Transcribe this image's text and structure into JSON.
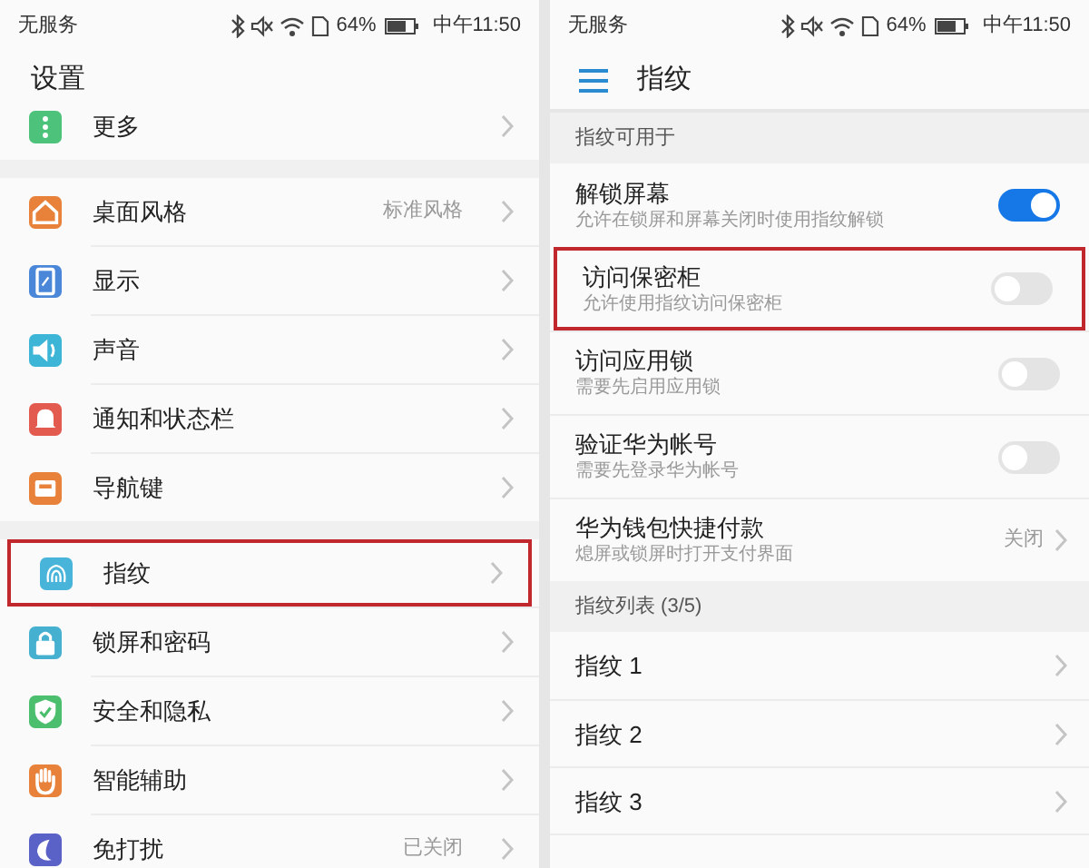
{
  "left_screen": {
    "status_bar": {
      "carrier": "无服务",
      "battery": "64%",
      "time": "中午11:50"
    },
    "title": "设置",
    "groups": [
      {
        "items": [
          {
            "label": "更多",
            "color": "#4cc27a",
            "highlighted": false
          }
        ]
      },
      {
        "items": [
          {
            "label": "桌面风格",
            "color": "#e8823a",
            "value": "标准风格",
            "highlighted": false
          },
          {
            "label": "显示",
            "color": "#4a87d8",
            "highlighted": false
          },
          {
            "label": "声音",
            "color": "#3db5d6",
            "highlighted": false
          },
          {
            "label": "通知和状态栏",
            "color": "#e35a4f",
            "highlighted": false
          },
          {
            "label": "导航键",
            "color": "#e8823a",
            "highlighted": false
          }
        ]
      },
      {
        "items": [
          {
            "label": "指纹",
            "color": "#48b4d9",
            "highlighted": true
          },
          {
            "label": "锁屏和密码",
            "color": "#46b0d0",
            "highlighted": false
          },
          {
            "label": "安全和隐私",
            "color": "#4cbf6e",
            "highlighted": false
          },
          {
            "label": "智能辅助",
            "color": "#e8823a",
            "highlighted": false
          },
          {
            "label": "免打扰",
            "color": "#5a62c8",
            "value": "已关闭",
            "highlighted": false
          }
        ]
      }
    ]
  },
  "right_screen": {
    "status_bar": {
      "carrier": "无服务",
      "battery": "64%",
      "time": "中午11:50"
    },
    "title": "指纹",
    "sections": [
      {
        "header": "指纹可用于",
        "items": [
          {
            "kind": "toggle",
            "title": "解锁屏幕",
            "subtitle": "允许在锁屏和屏幕关闭时使用指纹解锁",
            "on": true,
            "highlighted": false
          },
          {
            "kind": "toggle",
            "title": "访问保密柜",
            "subtitle": "允许使用指纹访问保密柜",
            "on": false,
            "highlighted": true
          },
          {
            "kind": "toggle",
            "title": "访问应用锁",
            "subtitle": "需要先启用应用锁",
            "on": false,
            "highlighted": false
          },
          {
            "kind": "toggle",
            "title": "验证华为帐号",
            "subtitle": "需要先登录华为帐号",
            "on": false,
            "highlighted": false
          },
          {
            "kind": "link",
            "title": "华为钱包快捷付款",
            "subtitle": "熄屏或锁屏时打开支付界面",
            "value": "关闭",
            "highlighted": false
          }
        ]
      },
      {
        "header": "指纹列表 (3/5)",
        "items": [
          {
            "kind": "link",
            "title": "指纹 1",
            "highlighted": false
          },
          {
            "kind": "link",
            "title": "指纹 2",
            "highlighted": false
          },
          {
            "kind": "link",
            "title": "指纹 3",
            "highlighted": false
          }
        ]
      }
    ]
  }
}
